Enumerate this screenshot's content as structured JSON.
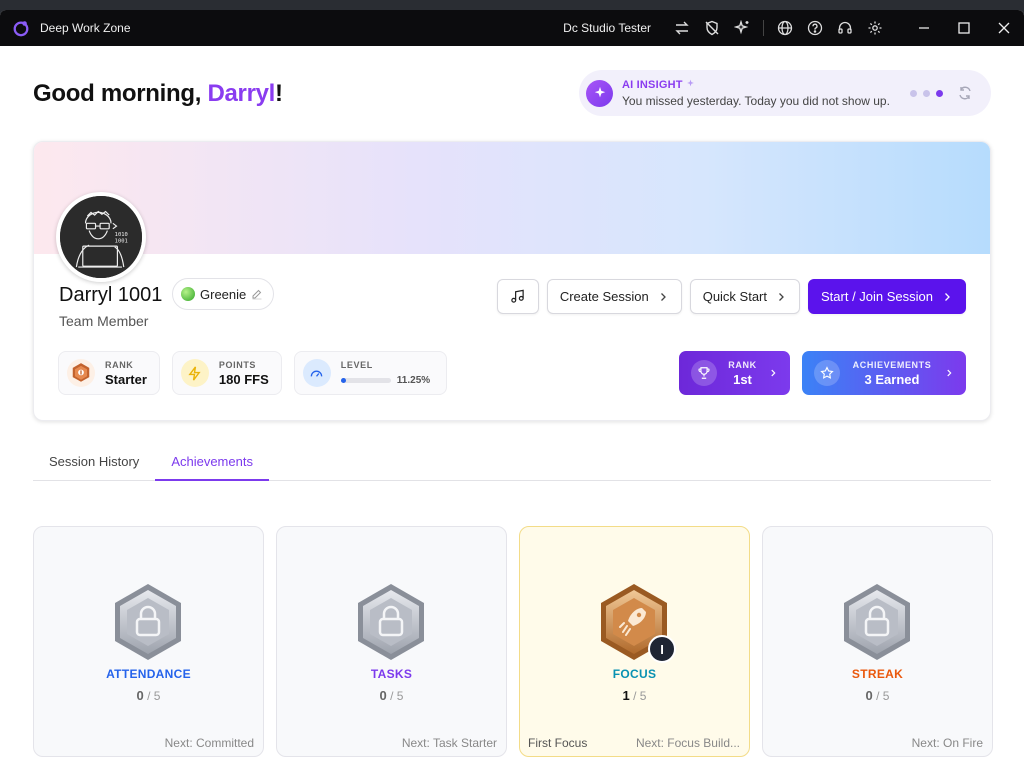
{
  "titlebar": {
    "app_title": "Deep Work Zone",
    "user_name": "Dc Studio Tester"
  },
  "greeting": {
    "prefix": "Good morning, ",
    "name": "Darryl",
    "suffix": "!"
  },
  "insight": {
    "label": "AI INSIGHT",
    "message": "You missed yesterday. Today you did not show up."
  },
  "profile": {
    "name": "Darryl 1001",
    "role": "Team Member",
    "badge": "Greenie",
    "avatar_text": "1010 1001"
  },
  "actions": {
    "create_session": "Create Session",
    "quick_start": "Quick Start",
    "start_join": "Start / Join Session"
  },
  "stats": {
    "rank_label": "RANK",
    "rank_value": "Starter",
    "points_label": "POINTS",
    "points_value": "180 FFS",
    "level_label": "LEVEL",
    "level_pct": "11.25%",
    "level_fraction": 0.1125
  },
  "pills": {
    "rank_label": "RANK",
    "rank_value": "1st",
    "ach_label": "ACHIEVEMENTS",
    "ach_value": "3 Earned"
  },
  "tabs": [
    "Session History",
    "Achievements"
  ],
  "achievements": [
    {
      "category": "ATTENDANCE",
      "color": "#2563eb",
      "current": "0",
      "total": " / 5",
      "next": "Next: Committed",
      "earned_name": ""
    },
    {
      "category": "TASKS",
      "color": "#7c3aed",
      "current": "0",
      "total": " / 5",
      "next": "Next: Task Starter",
      "earned_name": ""
    },
    {
      "category": "FOCUS",
      "color": "#0891b2",
      "current": "1",
      "total": " / 5",
      "next": "Next: Focus Build...",
      "earned_name": "First Focus",
      "level": "I"
    },
    {
      "category": "STREAK",
      "color": "#ea580c",
      "current": "0",
      "total": " / 5",
      "next": "Next: On Fire",
      "earned_name": ""
    }
  ],
  "colors": {
    "accent": "#7c3aed",
    "primary_button": "#5b13ec"
  }
}
